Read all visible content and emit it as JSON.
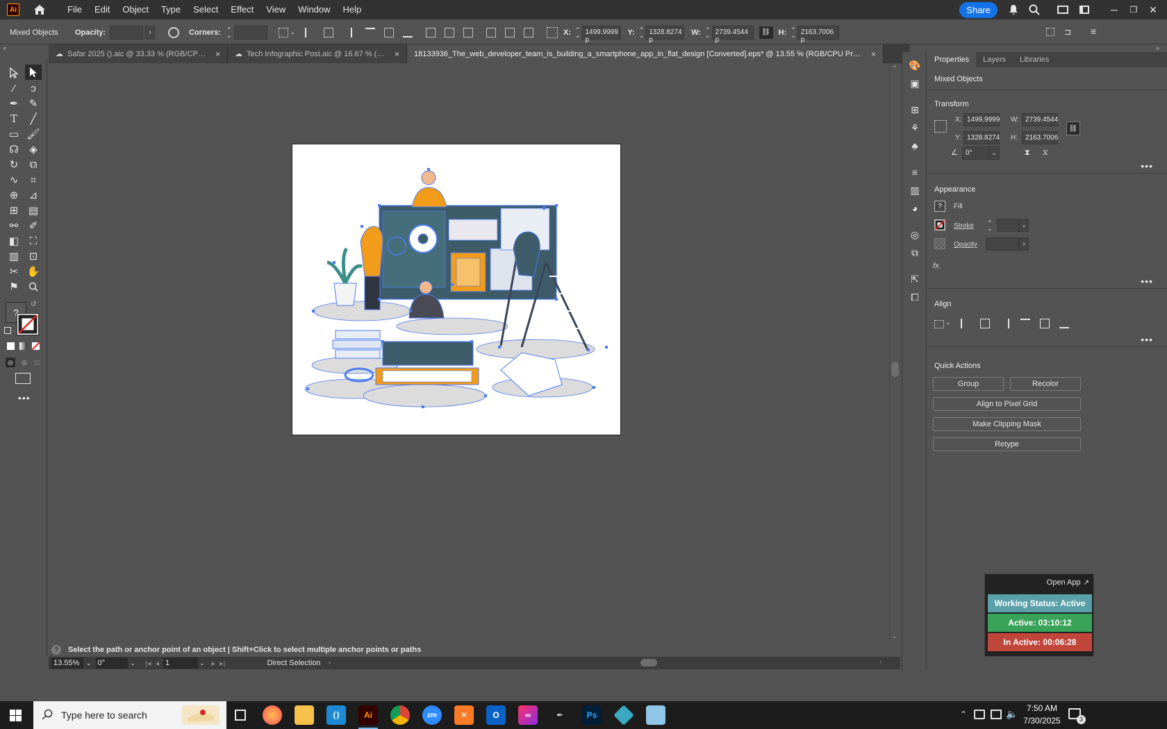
{
  "menubar": {
    "logo": "Ai",
    "menus": [
      "File",
      "Edit",
      "Object",
      "Type",
      "Select",
      "Effect",
      "View",
      "Window",
      "Help"
    ],
    "share_label": "Share"
  },
  "controlbar": {
    "selection_label": "Mixed Objects",
    "opacity_label": "Opacity:",
    "corners_label": "Corners:",
    "x_label": "X:",
    "x_value": "1499.9999 p",
    "y_label": "Y:",
    "y_value": "1328.8274 p",
    "w_label": "W:",
    "w_value": "2739.4544 p",
    "h_label": "H:",
    "h_value": "2163.7006 p"
  },
  "tabs": [
    {
      "label": "Safar 2025 ().aic @ 33.33 % (RGB/CPU Pr...",
      "close": "×"
    },
    {
      "label": "Tech Infographic Post.aic @ 16.67 % (RG...",
      "close": "×"
    },
    {
      "label": "18133936_The_web_developer_team_is_building_a_smartphone_app_in_flat_design [Converted].eps* @ 13.55 % (RGB/CPU Preview)",
      "close": "×"
    }
  ],
  "status": {
    "hint": "Select the path or anchor point of an object  |  Shift+Click to select multiple anchor points or paths",
    "zoom": "13.55%",
    "rotation": "0°",
    "artboard": "1",
    "tool": "Direct Selection"
  },
  "props": {
    "tabs": [
      "Properties",
      "Layers",
      "Libraries"
    ],
    "selection": "Mixed Objects",
    "transform_title": "Transform",
    "x_label": "X:",
    "x_value": "1499.9999",
    "y_label": "Y:",
    "y_value": "1328.8274",
    "w_label": "W:",
    "w_value": "2739.4544",
    "h_label": "H:",
    "h_value": "2163.7006",
    "angle": "0°",
    "appearance_title": "Appearance",
    "fill_label": "Fill",
    "stroke_label": "Stroke",
    "opacity_label": "Opacity",
    "fx_label": "fx.",
    "align_title": "Align",
    "quick_title": "Quick Actions",
    "group_label": "Group",
    "recolor_label": "Recolor",
    "align_pixel_label": "Align to Pixel Grid",
    "clipping_label": "Make Clipping Mask",
    "retype_label": "Retype"
  },
  "widget": {
    "open_app": "Open App",
    "working": "Working Status: Active",
    "active": "Active: 03:10:12",
    "inactive": "In Active: 00:06:28",
    "working_color": "#5aa0a8",
    "active_color": "#3aa35a",
    "inactive_color": "#c0463c"
  },
  "taskbar": {
    "search_placeholder": "Type here to search",
    "time": "7:50 AM",
    "date": "7/30/2025",
    "notifications": "3"
  }
}
